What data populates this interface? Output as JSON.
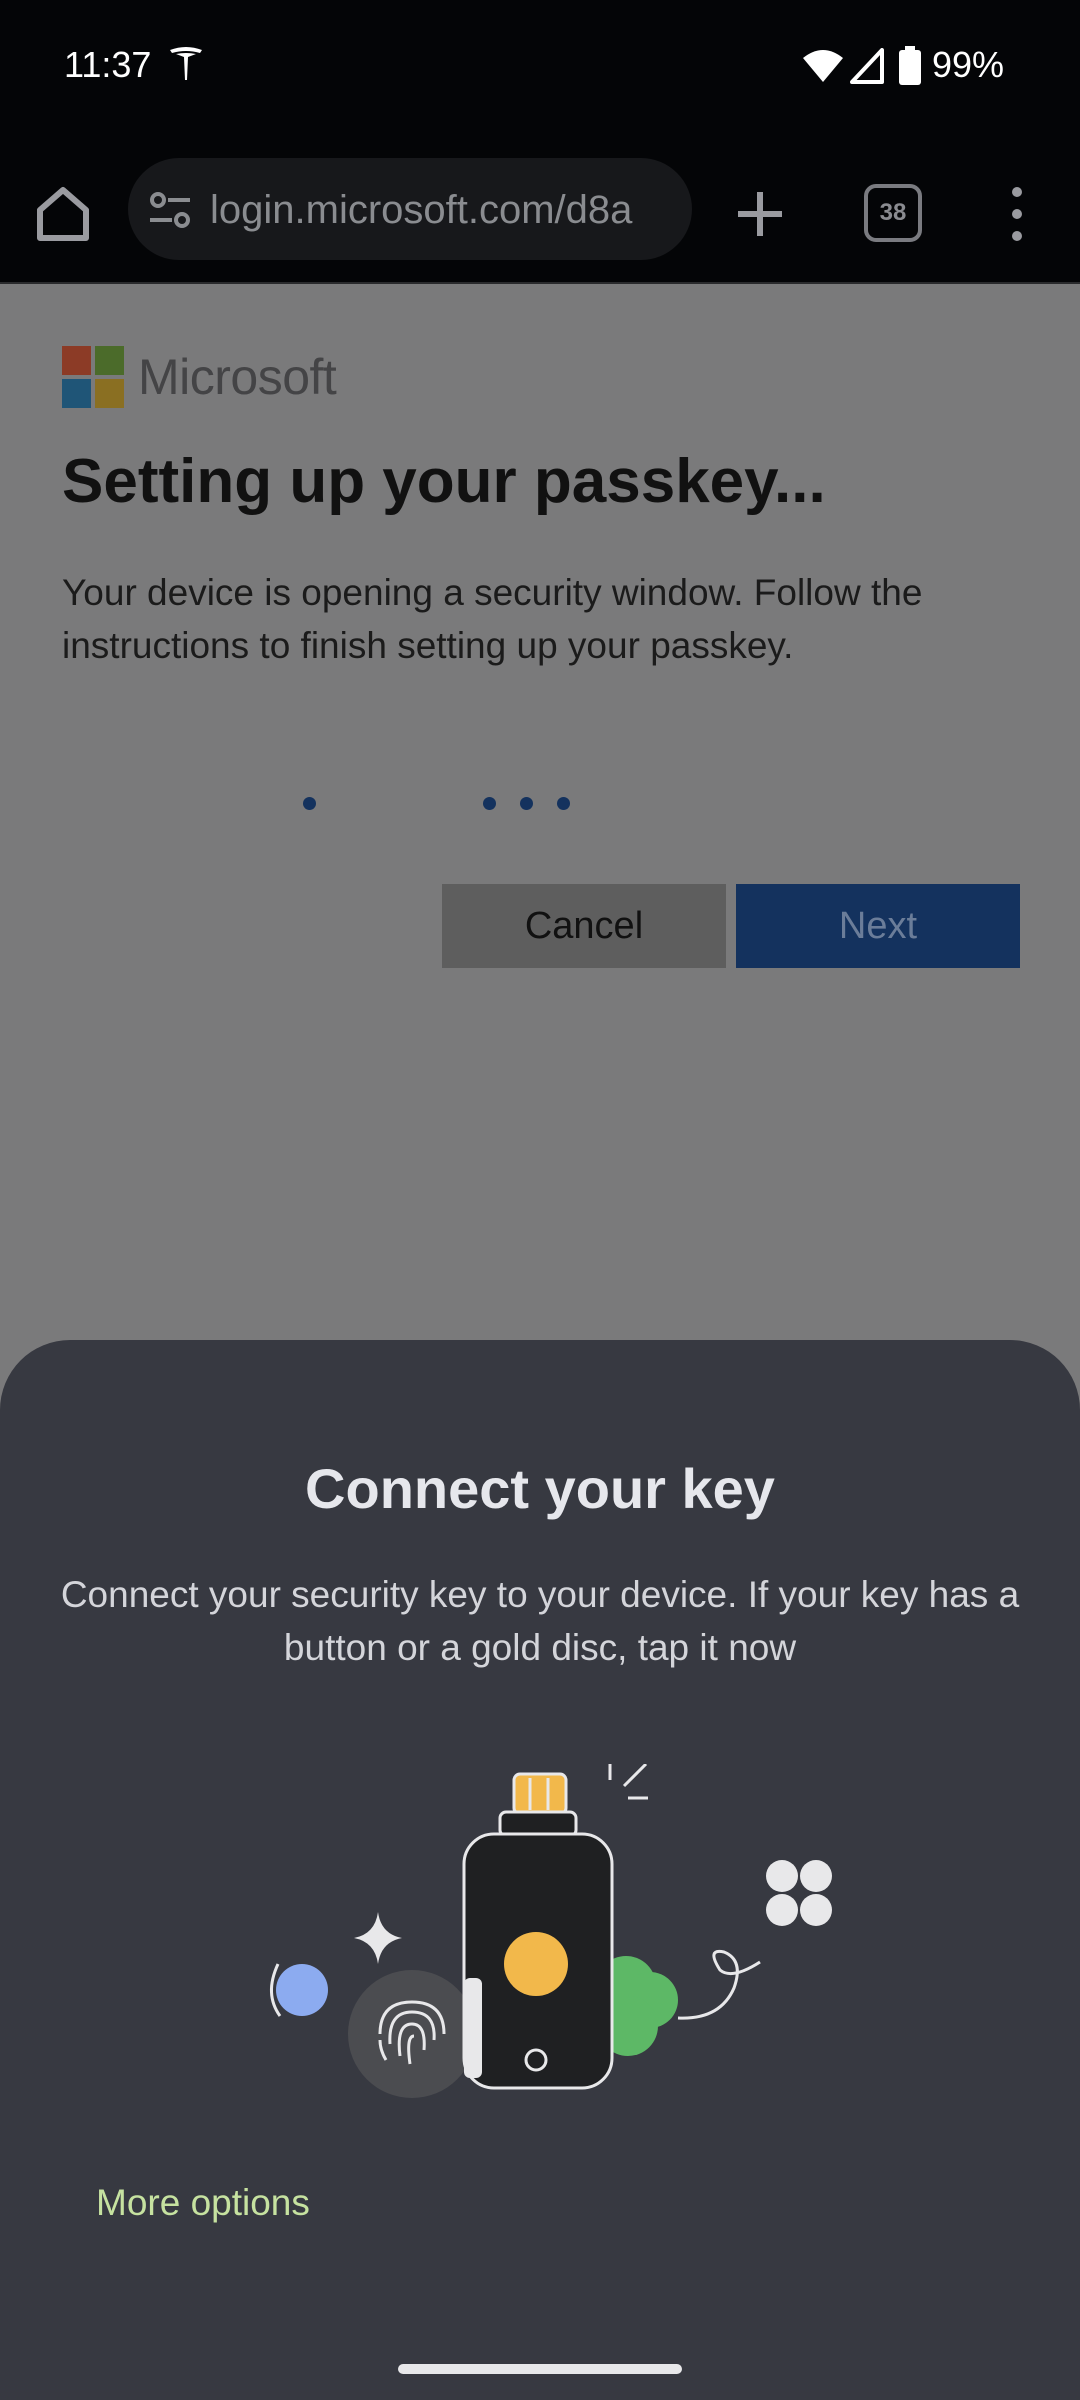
{
  "status_bar": {
    "time": "11:37",
    "battery": "99%",
    "icons": [
      "tesla-icon",
      "wifi-icon",
      "signal-icon",
      "battery-icon"
    ]
  },
  "browser": {
    "url": "login.microsoft.com/d8a",
    "tab_count": "38",
    "icons": [
      "home-icon",
      "tune-icon",
      "plus-icon",
      "more-vert-icon"
    ]
  },
  "page": {
    "brand": "Microsoft",
    "title": "Setting up your passkey...",
    "description": "Your device is opening a security window. Follow the instructions to finish setting up your passkey.",
    "cancel_label": "Cancel",
    "next_label": "Next",
    "colors": {
      "accent": "#14325e",
      "logo": [
        "#f25022",
        "#7fba00",
        "#00a4ef",
        "#ffb900"
      ]
    }
  },
  "sheet": {
    "title": "Connect your key",
    "description": "Connect your security key to your device. If your key has a button or a gold disc, tap it now",
    "more_options_label": "More options",
    "colors": {
      "background": "#373941",
      "link": "#c6e2a0"
    }
  }
}
